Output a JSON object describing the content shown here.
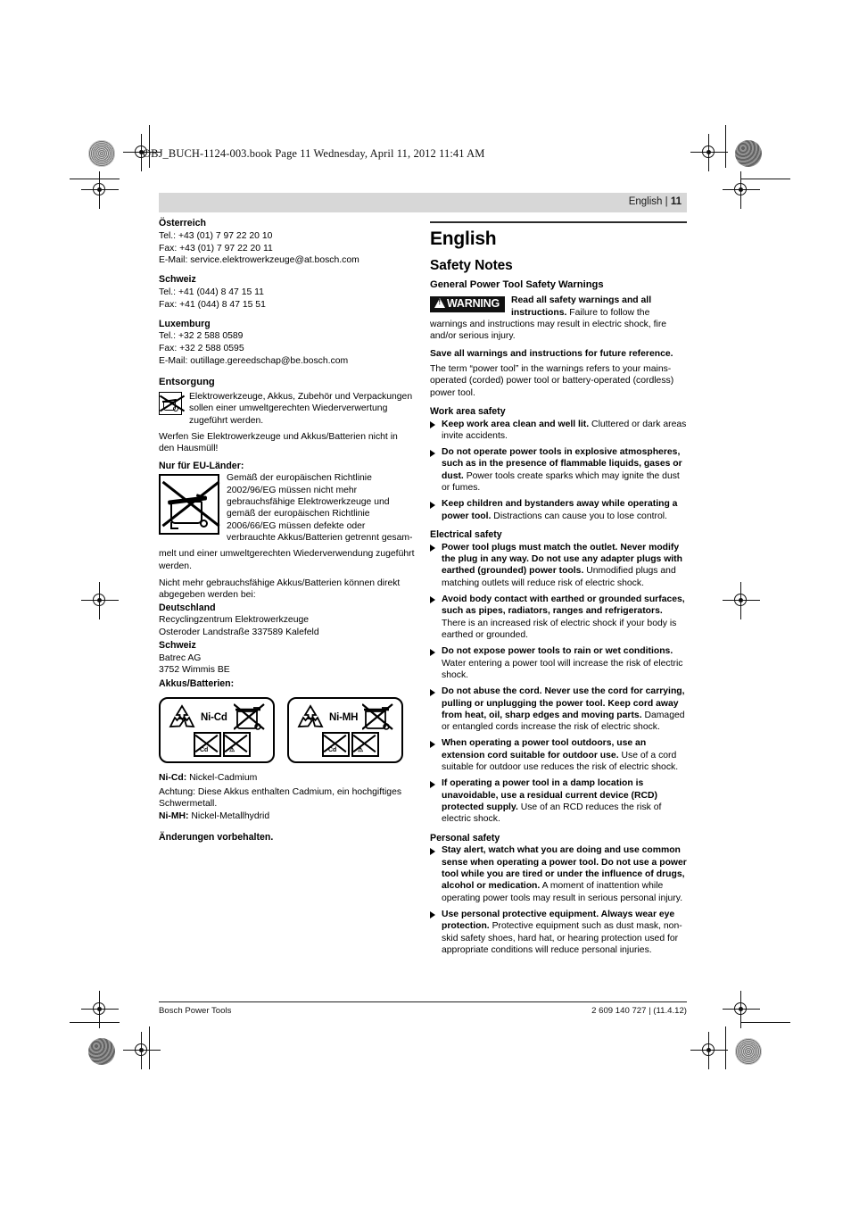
{
  "print_marks": {
    "file_info": "OBJ_BUCH-1124-003.book  Page 11  Wednesday, April 11, 2012  11:41 AM"
  },
  "running_head": {
    "language": "English",
    "separator": "|",
    "page_number": "11"
  },
  "left_column": {
    "contacts": [
      {
        "country": "Österreich",
        "lines": [
          "Tel.: +43 (01) 7 97 22 20 10",
          "Fax: +43 (01) 7 97 22 20 11",
          "E-Mail: service.elektrowerkzeuge@at.bosch.com"
        ]
      },
      {
        "country": "Schweiz",
        "lines": [
          "Tel.: +41 (044) 8 47 15 11",
          "Fax: +41 (044) 8 47 15 51"
        ]
      },
      {
        "country": "Luxemburg",
        "lines": [
          "Tel.: +32 2 588 0589",
          "Fax: +32 2 588 0595",
          "E-Mail: outillage.gereedschap@be.bosch.com"
        ]
      }
    ],
    "disposal_heading": "Entsorgung",
    "disposal_icon_text": "Elektrowerkzeuge, Akkus, Zubehör und Verpackungen sollen einer umweltgerechten Wiederverwertung zugeführt werden.",
    "disposal_paragraph": "Werfen Sie Elektrowerkzeuge und Akkus/Batterien nicht in den Hausmüll!",
    "eu_heading": "Nur für EU-Länder:",
    "eu_icon_text": "Gemäß der europäischen Richtlinie 2002/96/EG müssen nicht mehr gebrauchsfähige Elektrowerkzeuge und gemäß der europäischen Richtlinie 2006/66/EG müssen defekte oder verbrauchte Akkus/Batterien getrennt gesam-",
    "eu_continuation": "melt und einer umweltgerechten Wiederverwendung zugeführt werden.",
    "return_paragraph": "Nicht mehr gebrauchsfähige Akkus/Batterien können direkt abgegeben werden bei:",
    "return_sites": [
      {
        "country": "Deutschland",
        "lines": [
          "Recyclingzentrum Elektrowerkzeuge",
          "Osteroder Landstraße 337589 Kalefeld"
        ]
      },
      {
        "country": "Schweiz",
        "lines": [
          "Batrec AG",
          "3752 Wimmis BE"
        ]
      }
    ],
    "batteries_heading": "Akkus/Batterien:",
    "battery_labels": [
      {
        "chemistry": "Ni-Cd"
      },
      {
        "chemistry": "Ni-MH"
      }
    ],
    "nicd_label": "Ni-Cd:",
    "nicd_text": "Nickel-Cadmium",
    "nicd_warning": "Achtung: Diese Akkus enthalten Cadmium, ein hochgiftiges Schwermetall.",
    "nimh_label": "Ni-MH:",
    "nimh_text": "Nickel-Metallhydrid",
    "changes_note": "Änderungen vorbehalten."
  },
  "right_column": {
    "title": "English",
    "section_title": "Safety Notes",
    "subsection_title": "General Power Tool Safety Warnings",
    "warning_badge": "WARNING",
    "warning_bold": "Read all safety warnings and all instructions.",
    "warning_rest": " Failure to follow the warnings and instructions may result in electric shock, fire and/or serious injury.",
    "save_bold": "Save all warnings and instructions for future reference.",
    "term_paragraph": "The term “power tool” in the warnings refers to your mains-operated (corded) power tool or battery-operated (cordless) power tool.",
    "groups": [
      {
        "heading": "Work area safety",
        "items": [
          {
            "bold": "Keep work area clean and well lit.",
            "rest": " Cluttered or dark areas invite accidents."
          },
          {
            "bold": "Do not operate power tools in explosive atmospheres, such as in the presence of flammable liquids, gases or dust.",
            "rest": " Power tools create sparks which may ignite the dust or fumes."
          },
          {
            "bold": "Keep children and bystanders away while operating a power tool.",
            "rest": " Distractions can cause you to lose control."
          }
        ]
      },
      {
        "heading": "Electrical safety",
        "items": [
          {
            "bold": "Power tool plugs must match the outlet. Never modify the plug in any way. Do not use any adapter plugs with earthed (grounded) power tools.",
            "rest": " Unmodified plugs and matching outlets will reduce risk of electric shock."
          },
          {
            "bold": "Avoid body contact with earthed or grounded surfaces, such as pipes, radiators, ranges and refrigerators.",
            "rest": " There is an increased risk of electric shock if your body is earthed or grounded."
          },
          {
            "bold": "Do not expose power tools to rain or wet conditions.",
            "rest": " Water entering a power tool will increase the risk of electric shock."
          },
          {
            "bold": "Do not abuse the cord. Never use the cord for carrying, pulling or unplugging the power tool. Keep cord away from heat, oil, sharp edges and moving parts.",
            "rest": " Damaged or entangled cords increase the risk of electric shock."
          },
          {
            "bold": "When operating a power tool outdoors, use an extension cord suitable for outdoor use.",
            "rest": " Use of a cord suitable for outdoor use reduces the risk of electric shock."
          },
          {
            "bold": "If operating a power tool in a damp location is unavoidable, use a residual current device (RCD) protected supply.",
            "rest": " Use of an RCD reduces the risk of electric shock."
          }
        ]
      },
      {
        "heading": "Personal safety",
        "items": [
          {
            "bold": "Stay alert, watch what you are doing and use common sense when operating a power tool. Do not use a power tool while you are tired or under the influence of drugs, alcohol or medication.",
            "rest": " A moment of inattention while operating power tools may result in serious personal injury."
          },
          {
            "bold": "Use personal protective equipment. Always wear eye protection.",
            "rest": " Protective equipment such as dust mask, non-skid safety shoes, hard hat, or hearing protection used for appropriate conditions will reduce personal injuries."
          }
        ]
      }
    ]
  },
  "footer": {
    "left": "Bosch Power Tools",
    "right": "2 609 140 727 | (11.4.12)"
  }
}
